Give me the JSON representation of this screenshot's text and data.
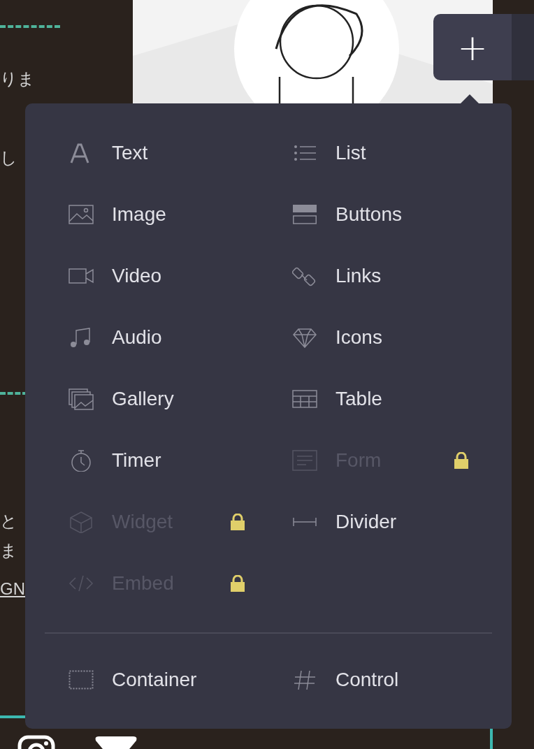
{
  "background_texts": [
    {
      "text": "りま",
      "underlined": false
    },
    {
      "text": "し",
      "underlined": false
    },
    {
      "text": "と",
      "underlined": false
    },
    {
      "text": "ま",
      "underlined": false
    },
    {
      "text": "GN",
      "underlined": true
    }
  ],
  "add_button": {
    "label": "+"
  },
  "menu": {
    "items": [
      {
        "label": "Text",
        "disabled": false,
        "locked": false
      },
      {
        "label": "List",
        "disabled": false,
        "locked": false
      },
      {
        "label": "Image",
        "disabled": false,
        "locked": false
      },
      {
        "label": "Buttons",
        "disabled": false,
        "locked": false
      },
      {
        "label": "Video",
        "disabled": false,
        "locked": false
      },
      {
        "label": "Links",
        "disabled": false,
        "locked": false
      },
      {
        "label": "Audio",
        "disabled": false,
        "locked": false
      },
      {
        "label": "Icons",
        "disabled": false,
        "locked": false
      },
      {
        "label": "Gallery",
        "disabled": false,
        "locked": false
      },
      {
        "label": "Table",
        "disabled": false,
        "locked": false
      },
      {
        "label": "Timer",
        "disabled": false,
        "locked": false
      },
      {
        "label": "Form",
        "disabled": true,
        "locked": true
      },
      {
        "label": "Widget",
        "disabled": true,
        "locked": true
      },
      {
        "label": "Divider",
        "disabled": false,
        "locked": false
      },
      {
        "label": "Embed",
        "disabled": true,
        "locked": true
      }
    ],
    "footer_items": [
      {
        "label": "Container",
        "disabled": false,
        "locked": false
      },
      {
        "label": "Control",
        "disabled": false,
        "locked": false
      }
    ]
  }
}
